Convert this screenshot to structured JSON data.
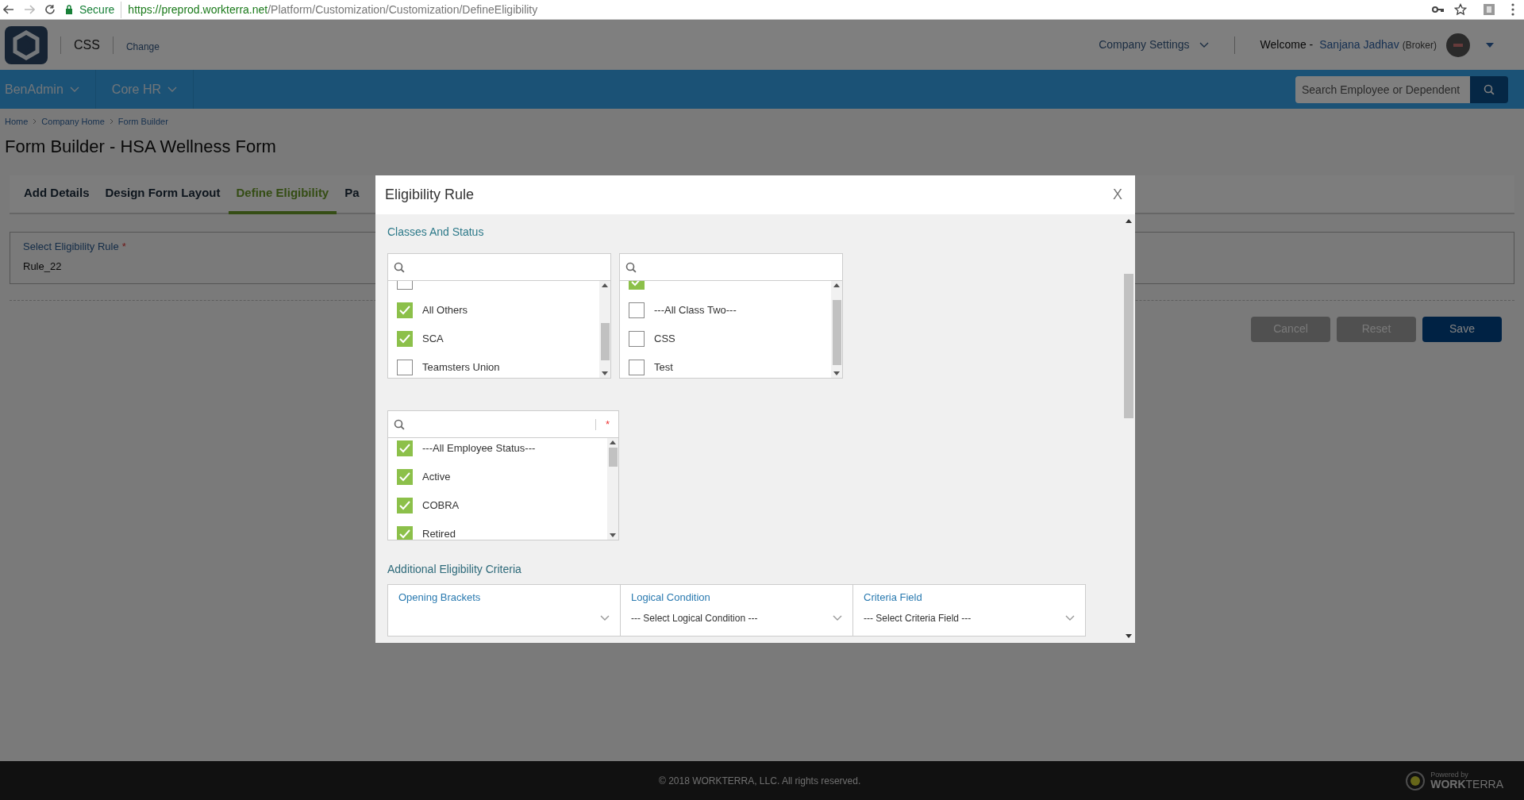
{
  "browser": {
    "security": "Secure",
    "url_host": "https://preprod.workterra.net",
    "url_path": "/Platform/Customization/Customization/DefineEligibility"
  },
  "header": {
    "company": "CSS",
    "change_link": "Change",
    "company_settings": "Company Settings",
    "welcome": "Welcome -",
    "user_name": "Sanjana Jadhav",
    "user_role": "(Broker)"
  },
  "nav": {
    "menus": [
      "BenAdmin",
      "Core HR"
    ],
    "search": {
      "placeholder": "Search Employee or Dependent"
    }
  },
  "breadcrumbs": [
    "Home",
    "Company Home",
    "Form Builder"
  ],
  "page_title": "Form Builder - HSA Wellness Form",
  "tabs": [
    {
      "label": "Add Details",
      "selected": false
    },
    {
      "label": "Design Form Layout",
      "selected": false
    },
    {
      "label": "Define Eligibility",
      "selected": true
    },
    {
      "label": "Pa",
      "selected": false
    }
  ],
  "rule_field": {
    "label": "Select Eligibility Rule",
    "required_mark": "*",
    "value": "Rule_22"
  },
  "buttons": [
    {
      "label": "Cancel",
      "kind": "secondary"
    },
    {
      "label": "Reset",
      "kind": "secondary"
    },
    {
      "label": "Save",
      "kind": "primary"
    }
  ],
  "modal": {
    "title": "Eligibility Rule",
    "close": "X",
    "section_title": "Classes And Status",
    "lists": [
      {
        "items": [
          {
            "checked": false
          },
          {
            "label": "All Others",
            "checked": true
          },
          {
            "label": "SCA",
            "checked": true
          },
          {
            "label": "Teamsters Union",
            "checked": false
          }
        ]
      },
      {
        "items": [
          {
            "checked": true
          },
          {
            "label": "---All Class Two---",
            "checked": false
          },
          {
            "label": "CSS",
            "checked": false
          },
          {
            "label": "Test",
            "checked": false
          }
        ]
      },
      {
        "required_mark": "*",
        "items": [
          {
            "label": "---All Employee Status---",
            "checked": true
          },
          {
            "label": "Active",
            "checked": true
          },
          {
            "label": "COBRA",
            "checked": true
          },
          {
            "label": "Retired",
            "checked": true
          }
        ]
      }
    ],
    "criteria_title": "Additional Eligibility Criteria",
    "criteria_fields": [
      {
        "label": "Opening Brackets"
      },
      {
        "label": "Logical Condition",
        "value": "--- Select Logical Condition ---"
      },
      {
        "label": "Criteria Field",
        "value": "--- Select Criteria Field ---"
      }
    ]
  },
  "footer": {
    "copyright": "© 2018 WORKTERRA, LLC. All rights reserved.",
    "powered_by": "Powered by",
    "brand": "**WORK**TERRA"
  }
}
